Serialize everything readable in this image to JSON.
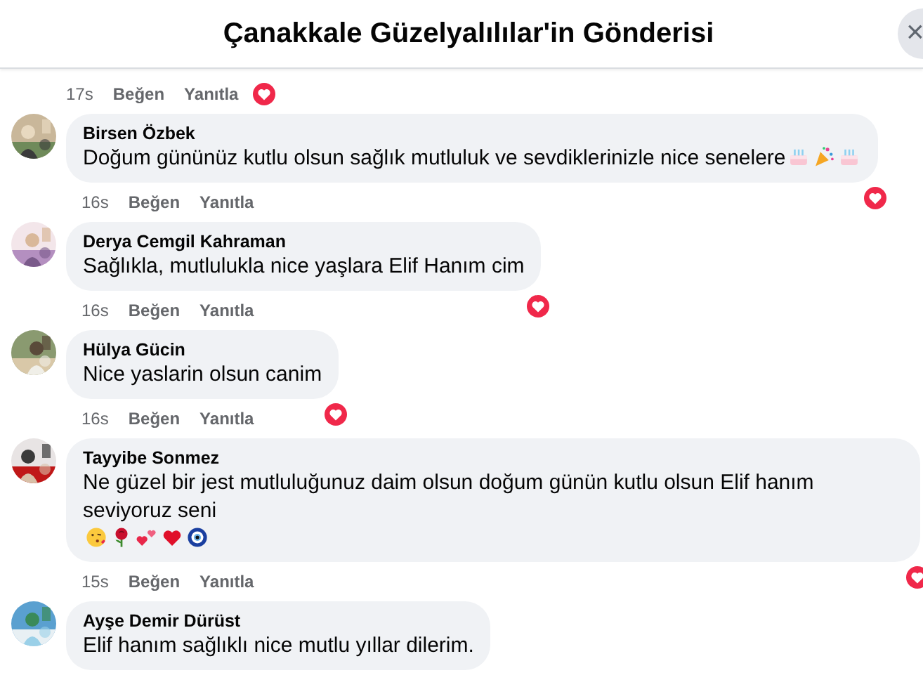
{
  "header": {
    "title": "Çanakkale Güzelyalılılar'in Gönderisi",
    "close": "×"
  },
  "partial_comment": {
    "time": "17s",
    "like": "Beğen",
    "reply": "Yanıtla",
    "loved": true
  },
  "comments": [
    {
      "author": "Birsen Özbek",
      "text": "Doğum gününüz kutlu olsun sağlık mutluluk ve sevdiklerinizle nice senelere",
      "emojis": [
        {
          "kind": "cake"
        },
        {
          "kind": "party"
        },
        {
          "kind": "cake"
        }
      ],
      "time": "16s",
      "like": "Beğen",
      "reply": "Yanıtla",
      "loved": true
    },
    {
      "author": "Derya Cemgil Kahraman",
      "text": "Sağlıkla, mutlulukla nice yaşlara Elif Hanım cim",
      "time": "16s",
      "like": "Beğen",
      "reply": "Yanıtla",
      "loved": true
    },
    {
      "author": "Hülya Gücin",
      "text": "Nice yaslarin olsun canim",
      "time": "16s",
      "like": "Beğen",
      "reply": "Yanıtla",
      "loved": true
    },
    {
      "author": "Tayyibe Sonmez",
      "text": "Ne güzel bir jest mutluluğunuz daim olsun doğum günün kutlu olsun Elif hanım seviyoruz seni",
      "emojis": [
        {
          "kind": "kiss"
        },
        {
          "kind": "rose"
        },
        {
          "kind": "hearts"
        },
        {
          "kind": "heart"
        },
        {
          "kind": "evil-eye"
        }
      ],
      "time": "15s",
      "like": "Beğen",
      "reply": "Yanıtla",
      "loved": true
    },
    {
      "author": "Ayşe Demir Dürüst",
      "text": "Elif hanım sağlıklı nice mutlu yıllar dilerim."
    }
  ]
}
